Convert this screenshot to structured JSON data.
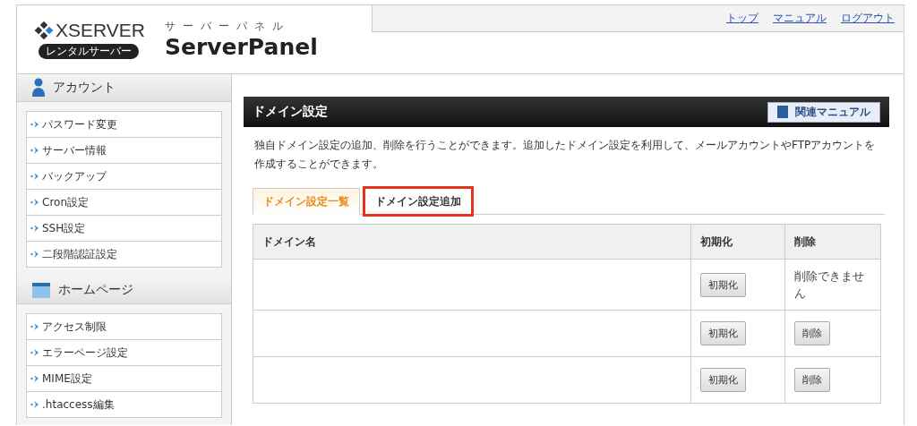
{
  "logo": {
    "brand": "XSERVER",
    "badge": "レンタルサーバー",
    "kana": "サーバーパネル",
    "title": "ServerPanel"
  },
  "top_links": [
    "トップ",
    "マニュアル",
    "ログアウト"
  ],
  "sidebar": [
    {
      "title": "アカウント",
      "kind": "person",
      "items": [
        "パスワード変更",
        "サーバー情報",
        "バックアップ",
        "Cron設定",
        "SSH設定",
        "二段階認証設定"
      ]
    },
    {
      "title": "ホームページ",
      "kind": "window",
      "items": [
        "アクセス制限",
        "エラーページ設定",
        "MIME設定",
        ".htaccess編集"
      ]
    }
  ],
  "panel": {
    "title": "ドメイン設定",
    "manual_button": "関連マニュアル",
    "description": "独自ドメイン設定の追加、削除を行うことができます。追加したドメイン設定を利用して、メールアカウントやFTPアカウントを作成することができます。",
    "tabs": [
      {
        "label": "ドメイン設定一覧",
        "selected": true,
        "highlighted": false
      },
      {
        "label": "ドメイン設定追加",
        "selected": false,
        "highlighted": true
      }
    ],
    "table": {
      "columns": [
        "ドメイン名",
        "初期化",
        "削除"
      ],
      "rows": [
        {
          "reset": "初期化",
          "delete": {
            "kind": "text",
            "text": "削除できません"
          }
        },
        {
          "reset": "初期化",
          "delete": {
            "kind": "button",
            "text": "削除"
          }
        },
        {
          "reset": "初期化",
          "delete": {
            "kind": "button",
            "text": "削除"
          }
        }
      ]
    }
  }
}
